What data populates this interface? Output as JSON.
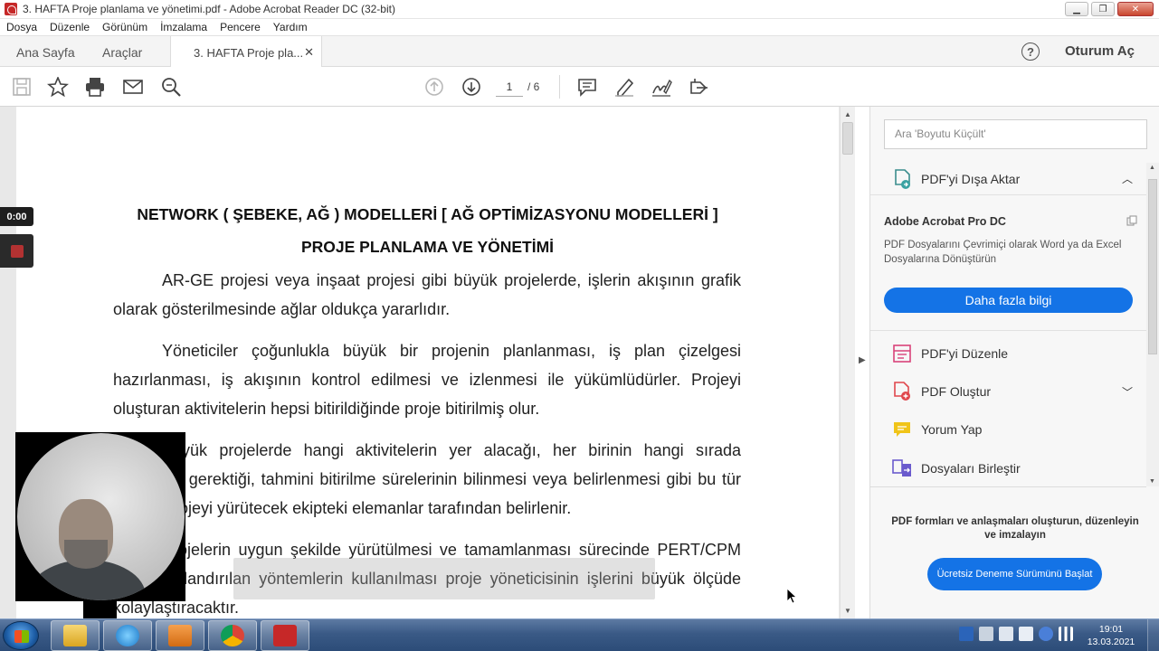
{
  "window": {
    "title": "3. HAFTA Proje planlama ve yönetimi.pdf - Adobe Acrobat Reader DC (32-bit)",
    "minimize": "▁",
    "maximize": "❐",
    "close": "✕"
  },
  "menu": [
    "Dosya",
    "Düzenle",
    "Görünüm",
    "İmzalama",
    "Pencere",
    "Yardım"
  ],
  "tabs": {
    "home": "Ana Sayfa",
    "tools": "Araçlar",
    "document": "3. HAFTA Proje pla...",
    "close": "✕"
  },
  "header": {
    "help": "?",
    "sign_in": "Oturum Aç"
  },
  "toolbar": {
    "current_page": "1",
    "total_pages": "/ 6"
  },
  "document": {
    "heading1": "NETWORK ( ŞEBEKE, AĞ ) MODELLERİ  [ AĞ OPTİMİZASYONU MODELLERİ ]",
    "heading2": "PROJE PLANLAMA VE YÖNETİMİ",
    "para1": "AR-GE projesi veya inşaat projesi gibi büyük projelerde, işlerin akışının grafik olarak gösterilmesinde ağlar oldukça yararlıdır.",
    "para2": "Yöneticiler çoğunlukla büyük bir projenin planlanması, iş plan çizelgesi hazırlanması, iş akışının kontrol edilmesi ve izlenmesi ile yükümlüdürler. Projeyi oluşturan aktivitelerin hepsi bitirildiğinde proje bitirilmiş olur.",
    "para3": "Büyük projelerde hangi aktivitelerin yer alacağı, her birinin hangi sırada yapılması gerektiği, tahmini bitirilme sürelerinin bilinmesi veya belirlenmesi gibi bu tür bilgiler projeyi yürütecek ekipteki elemanlar tarafından belirlenir.",
    "para4": "Projelerin uygun şekilde yürütülmesi ve tamamlanması sürecinde PERT/CPM olarak adlandırılan yöntemlerin kullanılması proje yöneticisinin işlerini büyük ölçüde kolaylaştıracaktır."
  },
  "right_panel": {
    "search_placeholder": "Ara 'Boyutu Küçült'",
    "export_label": "PDF'yi Dışa Aktar",
    "promo_title": "Adobe Acrobat Pro DC",
    "promo_text": "PDF Dosyalarını Çevrimiçi olarak Word ya da Excel Dosyalarına Dönüştürün",
    "learn_more": "Daha fazla bilgi",
    "items": [
      {
        "label": "PDF'yi Düzenle",
        "color": "#d9437a"
      },
      {
        "label": "PDF Oluştur",
        "color": "#e0474c"
      },
      {
        "label": "Yorum Yap",
        "color": "#f0c419"
      },
      {
        "label": "Dosyaları Birleştir",
        "color": "#6a5acd"
      }
    ],
    "footer_text": "PDF formları ve anlaşmaları oluşturun, düzenleyin ve imzalayın",
    "trial_button": "Ücretsiz Deneme Sürümünü Başlat"
  },
  "recorder": {
    "time": "0:00"
  },
  "taskbar": {
    "time": "19:01",
    "date": "13.03.2021"
  },
  "colors": {
    "accent": "#1473e6",
    "acrobat_red": "#c62828"
  }
}
